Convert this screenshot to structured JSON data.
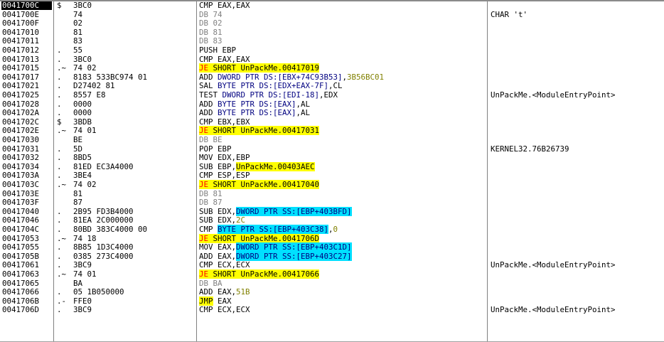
{
  "rows": [
    {
      "addr": "0041700C",
      "mark": "$",
      "hex": "3BC0",
      "asm": [
        {
          "t": "CMP EAX,EAX"
        }
      ],
      "cmt": "",
      "sel": true
    },
    {
      "addr": "0041700E",
      "mark": "",
      "hex": "74",
      "asm": [
        {
          "t": "DB 74",
          "c": "gray"
        }
      ],
      "cmt": "CHAR 't'"
    },
    {
      "addr": "0041700F",
      "mark": "",
      "hex": "02",
      "asm": [
        {
          "t": "DB 02",
          "c": "gray"
        }
      ],
      "cmt": ""
    },
    {
      "addr": "00417010",
      "mark": "",
      "hex": "81",
      "asm": [
        {
          "t": "DB 81",
          "c": "gray"
        }
      ],
      "cmt": ""
    },
    {
      "addr": "00417011",
      "mark": "",
      "hex": "83",
      "asm": [
        {
          "t": "DB 83",
          "c": "gray"
        }
      ],
      "cmt": ""
    },
    {
      "addr": "00417012",
      "mark": ".",
      "hex": "55",
      "asm": [
        {
          "t": "PUSH EBP"
        }
      ],
      "cmt": ""
    },
    {
      "addr": "00417013",
      "mark": ".",
      "hex": "3BC0",
      "asm": [
        {
          "t": "CMP EAX,EAX"
        }
      ],
      "cmt": ""
    },
    {
      "addr": "00417015",
      "mark": ".~",
      "hex": "74 02",
      "asm": [
        {
          "t": "JE",
          "c": "j"
        },
        {
          "t": " SHORT UnPackMe.00417019",
          "c": "ybg"
        }
      ],
      "cmt": ""
    },
    {
      "addr": "00417017",
      "mark": ".",
      "hex": "8183 533BC974 01",
      "asm": [
        {
          "t": "ADD "
        },
        {
          "t": "DWORD PTR DS:[EBX+74C93B53]",
          "c": "navy"
        },
        {
          "t": ","
        },
        {
          "t": "3B56BC01",
          "c": "olive"
        }
      ],
      "cmt": ""
    },
    {
      "addr": "00417021",
      "mark": ".",
      "hex": "D27402 81",
      "asm": [
        {
          "t": "SAL "
        },
        {
          "t": "BYTE PTR DS:[EDX+EAX-7F]",
          "c": "navy"
        },
        {
          "t": ",CL"
        }
      ],
      "cmt": ""
    },
    {
      "addr": "00417025",
      "mark": ".",
      "hex": "8557 E8",
      "asm": [
        {
          "t": "TEST "
        },
        {
          "t": "DWORD PTR DS:[EDI-18]",
          "c": "navy"
        },
        {
          "t": ",EDX"
        }
      ],
      "cmt": "UnPackMe.<ModuleEntryPoint>"
    },
    {
      "addr": "00417028",
      "mark": ".",
      "hex": "0000",
      "asm": [
        {
          "t": "ADD "
        },
        {
          "t": "BYTE PTR DS:[EAX]",
          "c": "navy"
        },
        {
          "t": ",AL"
        }
      ],
      "cmt": ""
    },
    {
      "addr": "0041702A",
      "mark": ".",
      "hex": "0000",
      "asm": [
        {
          "t": "ADD "
        },
        {
          "t": "BYTE PTR DS:[EAX]",
          "c": "navy"
        },
        {
          "t": ",AL"
        }
      ],
      "cmt": ""
    },
    {
      "addr": "0041702C",
      "mark": "$",
      "hex": "3BDB",
      "asm": [
        {
          "t": "CMP EBX,EBX"
        }
      ],
      "cmt": ""
    },
    {
      "addr": "0041702E",
      "mark": ".~",
      "hex": "74 01",
      "asm": [
        {
          "t": "JE",
          "c": "j"
        },
        {
          "t": " SHORT UnPackMe.00417031",
          "c": "ybg"
        }
      ],
      "cmt": ""
    },
    {
      "addr": "00417030",
      "mark": "",
      "hex": "BE",
      "asm": [
        {
          "t": "DB BE",
          "c": "gray"
        }
      ],
      "cmt": ""
    },
    {
      "addr": "00417031",
      "mark": ".",
      "hex": "5D",
      "asm": [
        {
          "t": "POP EBP"
        }
      ],
      "cmt": "KERNEL32.76B26739"
    },
    {
      "addr": "00417032",
      "mark": ".",
      "hex": "8BD5",
      "asm": [
        {
          "t": "MOV EDX,EBP"
        }
      ],
      "cmt": ""
    },
    {
      "addr": "00417034",
      "mark": ".",
      "hex": "81ED EC3A4000",
      "asm": [
        {
          "t": "SUB EBP,"
        },
        {
          "t": "UnPackMe.00403AEC",
          "c": "ybg"
        }
      ],
      "cmt": ""
    },
    {
      "addr": "0041703A",
      "mark": ".",
      "hex": "3BE4",
      "asm": [
        {
          "t": "CMP ESP,ESP"
        }
      ],
      "cmt": ""
    },
    {
      "addr": "0041703C",
      "mark": ".~",
      "hex": "74 02",
      "asm": [
        {
          "t": "JE",
          "c": "j"
        },
        {
          "t": " SHORT UnPackMe.00417040",
          "c": "ybg"
        }
      ],
      "cmt": ""
    },
    {
      "addr": "0041703E",
      "mark": "",
      "hex": "81",
      "asm": [
        {
          "t": "DB 81",
          "c": "gray"
        }
      ],
      "cmt": ""
    },
    {
      "addr": "0041703F",
      "mark": "",
      "hex": "87",
      "asm": [
        {
          "t": "DB 87",
          "c": "gray"
        }
      ],
      "cmt": ""
    },
    {
      "addr": "00417040",
      "mark": ".",
      "hex": "2B95 FD3B4000",
      "asm": [
        {
          "t": "SUB EDX,"
        },
        {
          "t": "DWORD PTR SS:[EBP+403BFD]",
          "c": "cyan"
        }
      ],
      "cmt": ""
    },
    {
      "addr": "00417046",
      "mark": ".",
      "hex": "81EA 2C000000",
      "asm": [
        {
          "t": "SUB EDX,"
        },
        {
          "t": "2C",
          "c": "olive"
        }
      ],
      "cmt": ""
    },
    {
      "addr": "0041704C",
      "mark": ".",
      "hex": "80BD 383C4000 00",
      "asm": [
        {
          "t": "CMP "
        },
        {
          "t": "BYTE PTR SS:[EBP+403C38]",
          "c": "cyan"
        },
        {
          "t": ","
        },
        {
          "t": "0",
          "c": "olive"
        }
      ],
      "cmt": ""
    },
    {
      "addr": "00417053",
      "mark": ".~",
      "hex": "74 18",
      "asm": [
        {
          "t": "JE",
          "c": "j"
        },
        {
          "t": " SHORT UnPackMe.0041706D",
          "c": "ybg"
        }
      ],
      "cmt": ""
    },
    {
      "addr": "00417055",
      "mark": ".",
      "hex": "8B85 1D3C4000",
      "asm": [
        {
          "t": "MOV EAX,"
        },
        {
          "t": "DWORD PTR SS:[EBP+403C1D]",
          "c": "cyan"
        }
      ],
      "cmt": ""
    },
    {
      "addr": "0041705B",
      "mark": ".",
      "hex": "0385 273C4000",
      "asm": [
        {
          "t": "ADD EAX,"
        },
        {
          "t": "DWORD PTR SS:[EBP+403C27]",
          "c": "cyan"
        }
      ],
      "cmt": ""
    },
    {
      "addr": "00417061",
      "mark": ".",
      "hex": "3BC9",
      "asm": [
        {
          "t": "CMP ECX,ECX"
        }
      ],
      "cmt": "UnPackMe.<ModuleEntryPoint>"
    },
    {
      "addr": "00417063",
      "mark": ".~",
      "hex": "74 01",
      "asm": [
        {
          "t": "JE",
          "c": "j"
        },
        {
          "t": " SHORT UnPackMe.00417066",
          "c": "ybg"
        }
      ],
      "cmt": ""
    },
    {
      "addr": "00417065",
      "mark": "",
      "hex": "BA",
      "asm": [
        {
          "t": "DB BA",
          "c": "gray"
        }
      ],
      "cmt": ""
    },
    {
      "addr": "00417066",
      "mark": ".",
      "hex": "05 1B050000",
      "asm": [
        {
          "t": "ADD EAX,"
        },
        {
          "t": "51B",
          "c": "olive"
        }
      ],
      "cmt": ""
    },
    {
      "addr": "0041706B",
      "mark": ".-",
      "hex": "FFE0",
      "asm": [
        {
          "t": "JMP",
          "c": "ybg"
        },
        {
          "t": " EAX"
        }
      ],
      "cmt": ""
    },
    {
      "addr": "0041706D",
      "mark": ".",
      "hex": "3BC9",
      "asm": [
        {
          "t": "CMP ECX,ECX"
        }
      ],
      "cmt": "UnPackMe.<ModuleEntryPoint>"
    }
  ]
}
